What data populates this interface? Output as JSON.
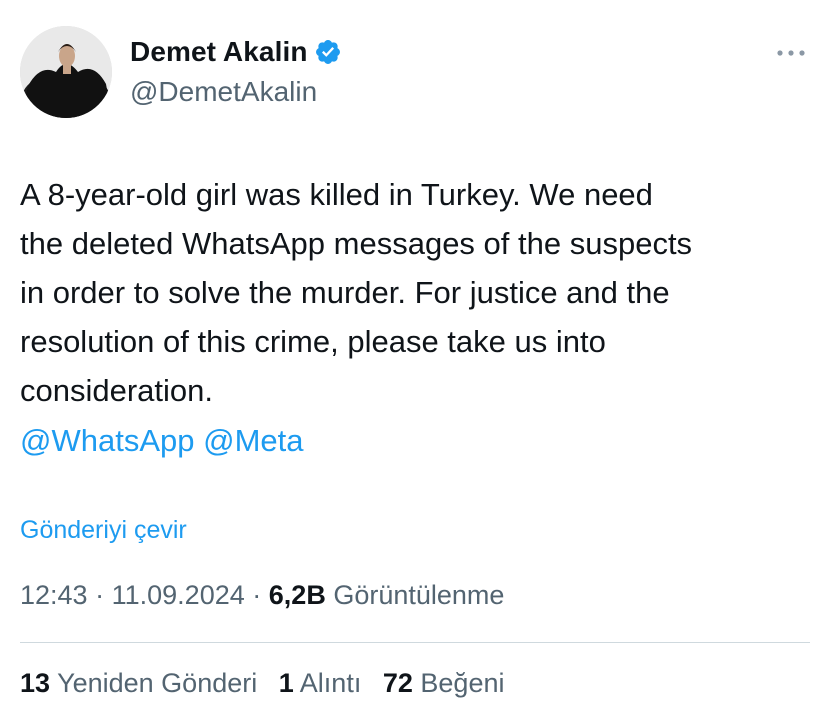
{
  "author": {
    "display_name": "Demet Akalin",
    "handle": "@DemetAkalin",
    "verified": true,
    "verified_icon": "verified-badge-icon",
    "verified_color": "#1d9bf0"
  },
  "more_icon": "more-horizontal-icon",
  "tweet": {
    "text": "A 8-year-old girl was killed in Turkey. We need\nthe deleted WhatsApp messages of the suspects\nin order to solve the murder. For justice and the\nresolution of this crime, please take us into\nconsideration.",
    "mentions": [
      "@WhatsApp",
      "@Meta"
    ],
    "translate_label": "Gönderiyi çevir"
  },
  "meta": {
    "time": "12:43",
    "separator": "·",
    "date": "11.09.2024",
    "views_count": "6,2B",
    "views_label": "Görüntülenme"
  },
  "stats": {
    "reposts_count": "13",
    "reposts_label": "Yeniden Gönderi",
    "quotes_count": "1",
    "quotes_label": "Alıntı",
    "likes_count": "72",
    "likes_label": "Beğeni"
  },
  "colors": {
    "link": "#1d9bf0",
    "secondary_text": "#536471",
    "primary_text": "#0f1419",
    "divider": "#cfd9de"
  }
}
